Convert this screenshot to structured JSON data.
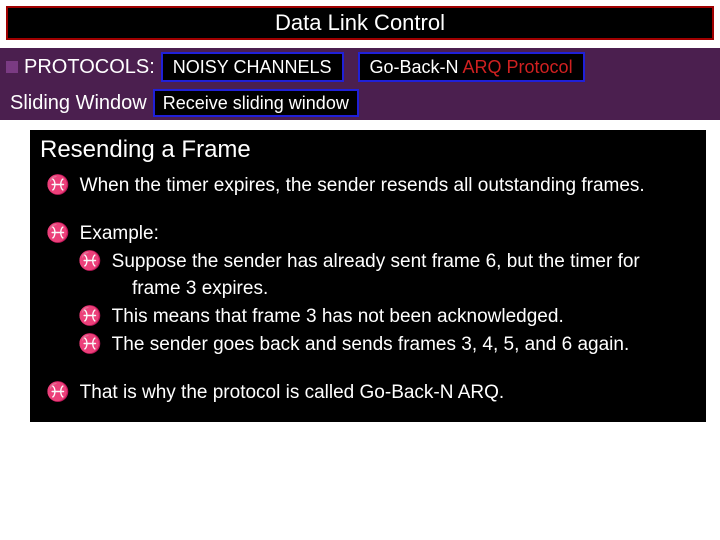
{
  "title": "Data Link Control",
  "row2": {
    "protocols_label": "PROTOCOLS:",
    "noisy_channels": "NOISY CHANNELS",
    "gbn_prefix": "Go-Back-N ",
    "gbn_red": "ARQ Protocol"
  },
  "row3": {
    "sliding_window": "Sliding Window",
    "receive": "Receive sliding window"
  },
  "content": {
    "section_title": "Resending a Frame",
    "b1": "When the timer expires, the sender resends all outstanding frames.",
    "b2": "Example:",
    "b2a_line1": "Suppose the sender has already sent frame 6, but the timer for",
    "b2a_line2": "frame 3 expires.",
    "b2b": "This means that frame 3 has not been acknowledged.",
    "b2c": "The sender goes back and sends frames 3, 4, 5, and 6 again.",
    "b3": "That is why the protocol is called Go-Back-N ARQ."
  },
  "glyph": "♓"
}
